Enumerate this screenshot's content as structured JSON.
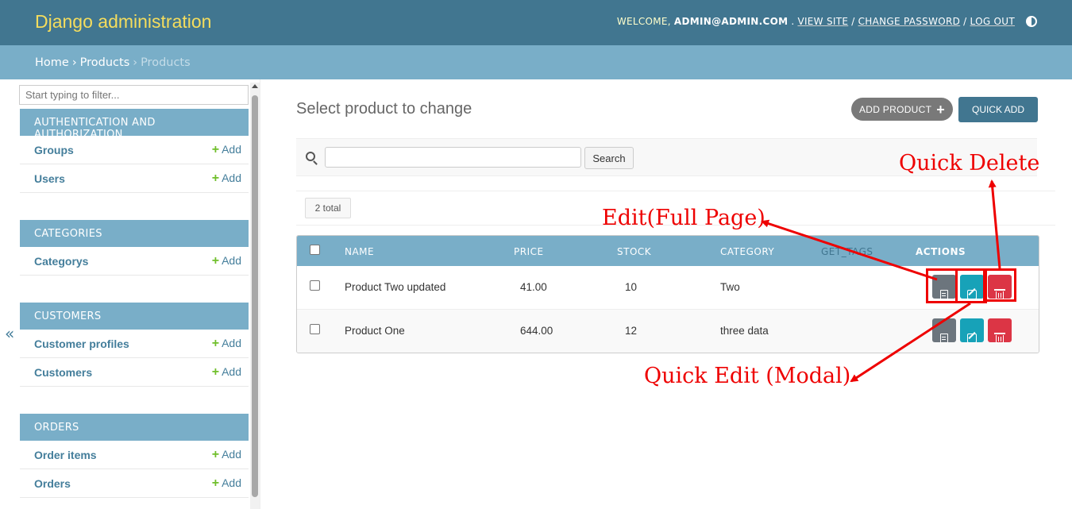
{
  "header": {
    "branding": "Django administration",
    "welcome": "WELCOME,",
    "user": "ADMIN@ADMIN.COM",
    "view_site": "VIEW SITE",
    "change_password": "CHANGE PASSWORD",
    "log_out": "LOG OUT"
  },
  "breadcrumbs": {
    "home": "Home",
    "app": "Products",
    "current": "Products"
  },
  "sidebar": {
    "filter_placeholder": "Start typing to filter...",
    "collapse": "«",
    "add_label": "Add",
    "modules": [
      {
        "caption": "AUTHENTICATION AND AUTHORIZATION",
        "items": [
          "Groups",
          "Users"
        ]
      },
      {
        "caption": "CATEGORIES",
        "items": [
          "Categorys"
        ]
      },
      {
        "caption": "CUSTOMERS",
        "items": [
          "Customer profiles",
          "Customers"
        ]
      },
      {
        "caption": "ORDERS",
        "items": [
          "Order items",
          "Orders"
        ]
      }
    ]
  },
  "main": {
    "title": "Select product to change",
    "add_button": "ADD PRODUCT",
    "quick_add_button": "QUICK ADD",
    "search_button": "Search",
    "total": "2 total",
    "columns": [
      "NAME",
      "PRICE",
      "STOCK",
      "CATEGORY",
      "GET_TAGS",
      "ACTIONS"
    ],
    "rows": [
      {
        "name": "Product Two updated",
        "price": "41.00",
        "stock": "10",
        "category": "Two"
      },
      {
        "name": "Product One",
        "price": "644.00",
        "stock": "12",
        "category": "three data"
      }
    ]
  },
  "annotations": {
    "quick_delete": "Quick Delete",
    "edit_full": "Edit(Full Page)",
    "quick_edit": "Quick Edit (Modal)"
  },
  "colors": {
    "header": "#417690",
    "breadcrumbs": "#79aec8",
    "branding": "#f5dd5d",
    "annotation": "#ee0000"
  }
}
